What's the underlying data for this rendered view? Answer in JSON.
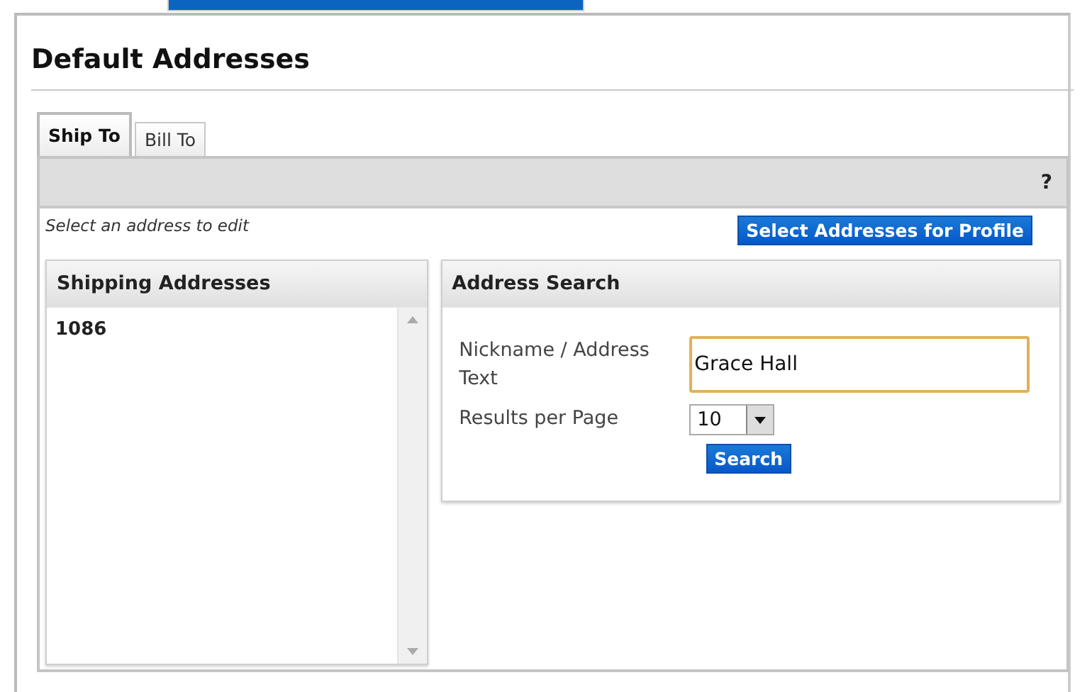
{
  "page": {
    "title": "Default Addresses"
  },
  "tabs": [
    {
      "label": "Ship To",
      "selected": true
    },
    {
      "label": "Bill To",
      "selected": false
    }
  ],
  "toolbar": {
    "help": "?"
  },
  "hint": "Select an address to edit",
  "profile_button": "Select Addresses for Profile",
  "shipping_addresses": {
    "title": "Shipping Addresses",
    "items": [
      "1086"
    ]
  },
  "address_search": {
    "title": "Address Search",
    "nickname_label": "Nickname / Address Text",
    "nickname_value": "Grace Hall",
    "results_label": "Results per Page",
    "results_value": "10",
    "search_button": "Search"
  }
}
